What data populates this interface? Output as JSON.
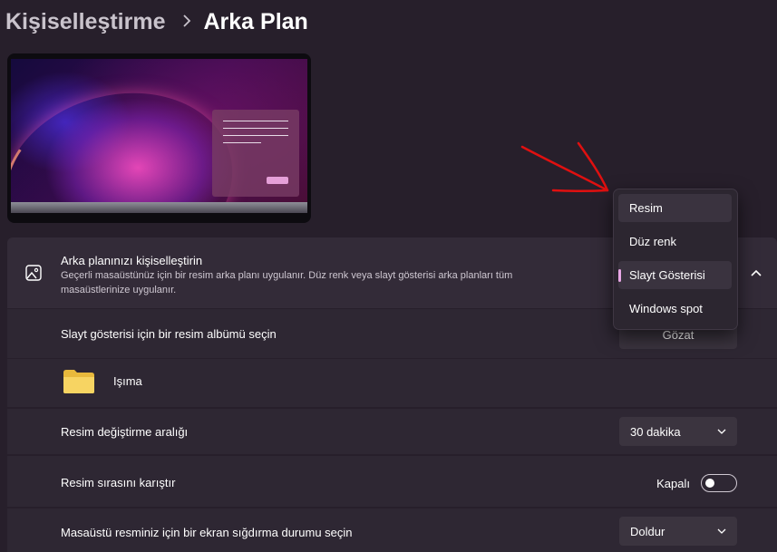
{
  "breadcrumb": {
    "parent": "Kişiselleştirme",
    "current": "Arka Plan"
  },
  "personalize": {
    "title": "Arka planınızı kişiselleştirin",
    "description": "Geçerli masaüstünüz için bir resim arka planı uygulanır. Düz renk veya slayt gösterisi arka planları tüm masaüstlerinize uygulanır."
  },
  "album": {
    "label": "Slayt gösterisi için bir resim albümü seçin",
    "browse_label": "Gözat"
  },
  "folder": {
    "name": "Işıma"
  },
  "interval": {
    "label": "Resim değiştirme aralığı",
    "value": "30 dakika"
  },
  "shuffle": {
    "label": "Resim sırasını karıştır",
    "state": "Kapalı",
    "on": false
  },
  "fit": {
    "label": "Masaüstü resminiz için bir ekran sığdırma durumu seçin",
    "value": "Doldur"
  },
  "background_menu": {
    "options": [
      "Resim",
      "Düz renk",
      "Slayt Gösterisi",
      "Windows spot"
    ],
    "selected": "Slayt Gösterisi",
    "hovered": "Resim"
  },
  "colors": {
    "accent": "#e9a7e6",
    "annotation_arrow": "#e01010",
    "background": "#271f2b",
    "card": "#332b38"
  }
}
